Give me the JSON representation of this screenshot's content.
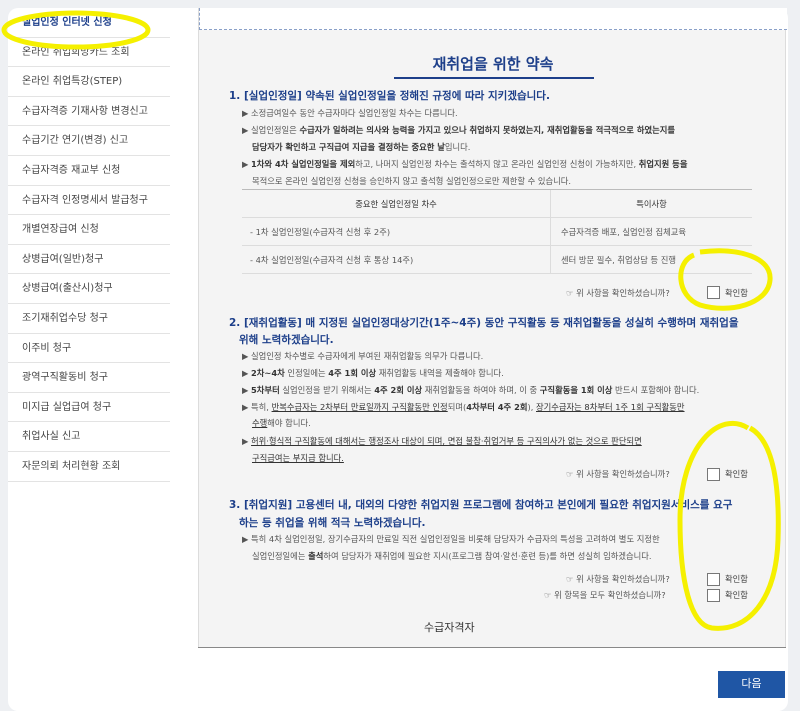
{
  "sidebar": {
    "items": [
      "실업인정 인터넷 신청",
      "온라인 취업희망카드 조회",
      "온라인 취업특강(STEP)",
      "수급자격증 기재사항 변경신고",
      "수급기간 연기(변경) 신고",
      "수급자격증 재교부 신청",
      "수급자격 인정명세서 발급청구",
      "개별연장급여 신청",
      "상병급여(일반)청구",
      "상병급여(출산시)청구",
      "조기재취업수당 청구",
      "이주비 청구",
      "광역구직활동비 청구",
      "미지급 실업급여 청구",
      "취업사실 신고",
      "자문의뢰 처리현황 조회"
    ]
  },
  "main": {
    "title": "재취업을 위한 약속",
    "sec1": {
      "head": "1. [실업인정일] 약속된 실업인정일을 정해진 규정에 따라 지키겠습니다.",
      "b1": "▶ 소정급여일수 동안 수급자마다 실업인정일 차수는 다릅니다.",
      "b2a": "▶ 실업인정일은 ",
      "b2b": "수급자가 일하려는 의사와 능력을 가지고 있으나 취업하지 못하였는지, 재취업활동을 적극적으로 하였는지를",
      "b2c": "담당자가 확인하고 구직급여 지급을 결정하는 중요한 날",
      "b2d": "입니다.",
      "b3a": "▶ ",
      "b3b": "1차와 4차 실업인정일을 제외",
      "b3c": "하고, 나머지 실업인정 차수는 출석하지 않고 온라인 실업인정 신청이 가능하지만, ",
      "b3d": "취업지원 등을",
      "b3e": "목적으로 온라인 실업인정 신청을 승인하지 않고 출석형 실업인정으로만 제한할 수 있습니다.",
      "table": {
        "headers": [
          "중요한 실업인정일 차수",
          "특이사항"
        ],
        "rows": [
          [
            "- 1차 실업인정일(수급자격 신청 후 2주)",
            "수급자격증 배포, 실업인정 집체교육"
          ],
          [
            "- 4차 실업인정일(수급자격 신청 후 통상 14주)",
            "센터 방문 필수, 취업상담 등 진행"
          ]
        ]
      },
      "confirm_q": "☞ 위 사항을 확인하셨습니까?",
      "confirm_label": "확인함"
    },
    "sec2": {
      "head1": "2. [재취업활동] 매 지정된 실업인정대상기간(1주~4주) 동안 구직활동 등 재취업활동을 성실히 수행하며 재취업을",
      "head2": "위해 노력하겠습니다.",
      "b1": "▶ 실업인정 차수별로 수급자에게 부여된 재취업활동 의무가 다릅니다.",
      "b2a": "▶ ",
      "b2b": "2차~4차",
      "b2c": " 인정일에는 ",
      "b2d": "4주 1회 이상",
      "b2e": " 재취업활동 내역을 제출해야 합니다.",
      "b3a": "▶ ",
      "b3b": "5차부터",
      "b3c": " 실업인정을 받기 위해서는 ",
      "b3d": "4주 2회 이상",
      "b3e": " 재취업활동을 하여야 하며, 이 중 ",
      "b3f": "구직활동을 1회 이상",
      "b3g": " 반드시 포함해야 합니다.",
      "b4a": "▶ 특히, ",
      "b4b": "반복수급자는 2차부터 만료일까지 구직활동만 인정",
      "b4c": "되며(",
      "b4d": "4차부터 4주 2회",
      "b4e": "), ",
      "b4f": "장기수급자는 8차부터 1주 1회 구직활동만",
      "b4g": "수행",
      "b4h": "해야 합니다.",
      "b5a": "▶ ",
      "b5b": "허위·형식적 구직활동에 대해서는 행정조사 대상이 되며, 면접 불참·취업거부 등 구직의사가 없는 것으로 판단되면",
      "b5c": "구직급여는 부지급 합니다.",
      "confirm_q": "☞ 위 사항을 확인하셨습니까?",
      "confirm_label": "확인함"
    },
    "sec3": {
      "head1": "3. [취업지원] 고용센터 내, 대외의 다양한 취업지원 프로그램에 참여하고 본인에게 필요한 취업지원서비스를 요구",
      "head2": "하는 등 취업을 위해 적극 노력하겠습니다.",
      "b1a": "▶ 특히 4차 실업인정일, 장기수급자의 만료일 직전 실업인정일을 비롯해 담당자가 수급자의 특성을 고려하여 별도 지정한",
      "b1b": "실업인정일에는 ",
      "b1c": "출석",
      "b1d": "하여 담당자가 재취업에 필요한 지시(프로그램 참여·알선·훈련 등)를 하면 성실히 임하겠습니다.",
      "confirm_q": "☞ 위 사항을 확인하셨습니까?",
      "confirm_label": "확인함",
      "confirm_all_q": "☞ 위 항목을 모두 확인하셨습니까?",
      "confirm_all_label": "확인함"
    },
    "applicant_label": "수급자격자"
  },
  "buttons": {
    "next": "다음"
  },
  "colors": {
    "accent": "#1d3f8a",
    "button": "#1f56a5",
    "highlight": "#f5f000"
  }
}
